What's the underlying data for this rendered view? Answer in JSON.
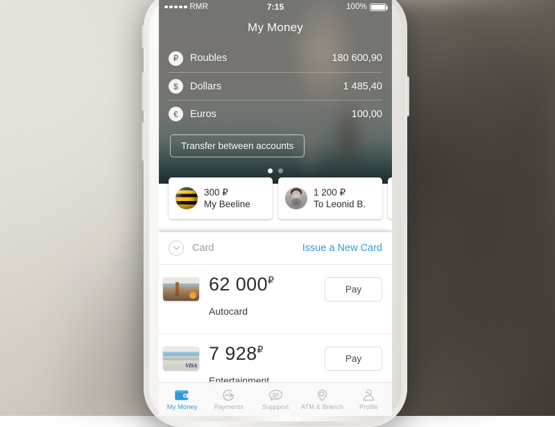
{
  "device": {
    "name": "white-smartphone"
  },
  "status_bar": {
    "carrier": "RMR",
    "signal_dots": 5,
    "time": "7:15",
    "battery_percent": "100%"
  },
  "header": {
    "title": "My Money",
    "balances": [
      {
        "icon": "rouble-icon",
        "symbol": "₽",
        "label": "Roubles",
        "value": "180 600,90"
      },
      {
        "icon": "dollar-icon",
        "symbol": "$",
        "label": "Dollars",
        "value": "1 485,40"
      },
      {
        "icon": "euro-icon",
        "symbol": "€",
        "label": "Euros",
        "value": "100,00"
      }
    ],
    "transfer_button": "Transfer between accounts",
    "page_dots": {
      "count": 2,
      "active_index": 0
    }
  },
  "quick_actions": [
    {
      "icon": "beeline-logo-icon",
      "amount": "300 ₽",
      "name": "My Beeline"
    },
    {
      "icon": "avatar",
      "amount": "1 200 ₽",
      "name": "To Leonid B."
    }
  ],
  "card_section": {
    "collapse_icon": "chevron-down-icon",
    "title": "Card",
    "action_link": "Issue a New Card",
    "link_color": "#2d9ddb",
    "cards": [
      {
        "thumb": "venice-card-thumb",
        "amount": "62 000",
        "currency": "₽",
        "name": "Autocard",
        "pay_label": "Pay"
      },
      {
        "thumb": "visa-beach-card-thumb",
        "amount": "7 928",
        "currency": "₽",
        "name": "Entertainment",
        "pay_label": "Pay",
        "visa_mark": "VISA"
      }
    ]
  },
  "tab_bar": {
    "active_color": "#2d9ddb",
    "inactive_color": "#b0b3b6",
    "tabs": [
      {
        "icon": "wallet-icon",
        "label": "My Money",
        "active": true
      },
      {
        "icon": "transfer-arrow-icon",
        "label": "Payments",
        "active": false
      },
      {
        "icon": "chat-bubble-icon",
        "label": "Suppport",
        "active": false
      },
      {
        "icon": "map-pin-icon",
        "label": "ATM & Branch",
        "active": false
      },
      {
        "icon": "person-icon",
        "label": "Profile",
        "active": false
      }
    ]
  }
}
